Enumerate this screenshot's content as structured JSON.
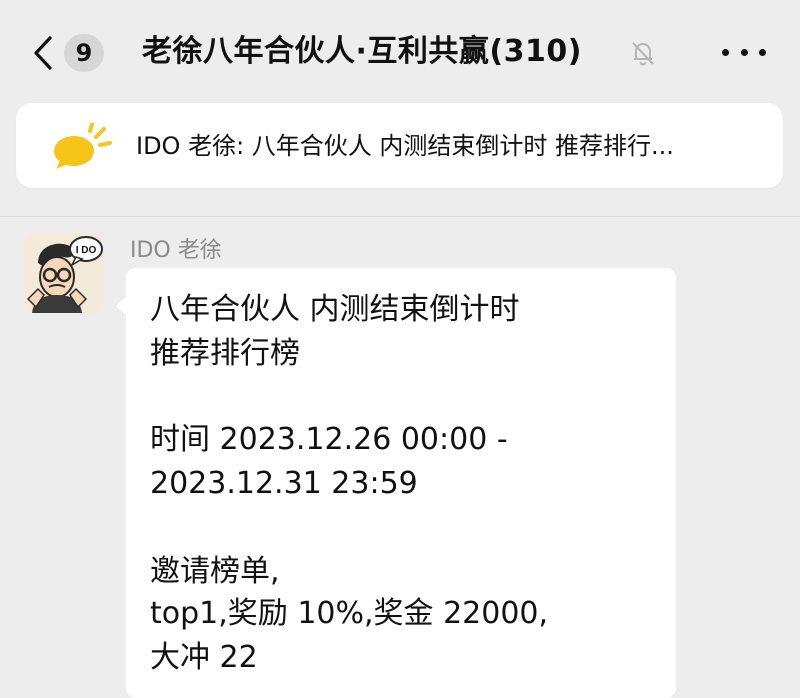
{
  "header": {
    "unread_count": "9",
    "title": "老徐八年合伙人·互利共赢(310)",
    "icons": {
      "back": "chevron-left-icon",
      "mute": "bell-muted-icon",
      "more": "more-dots-icon"
    }
  },
  "pinned": {
    "text": "IDO 老徐: 八年合伙人 内测结束倒计时 推荐排行...",
    "icon": "megaphone-icon",
    "accent": "#f5c518"
  },
  "message": {
    "sender": "IDO 老徐",
    "avatar_badge": "I DO",
    "lines": [
      "八年合伙人 内测结束倒计时",
      "推荐排行榜",
      "",
      "时间 2023.12.26 00:00 -",
      "2023.12.31 23:59",
      "",
      "邀请榜单,",
      "top1,奖励 10%,奖金 22000,",
      "大冲 22"
    ]
  },
  "colors": {
    "background": "#ededed",
    "bubble": "#ffffff",
    "sender_text": "#8a8a8a"
  }
}
